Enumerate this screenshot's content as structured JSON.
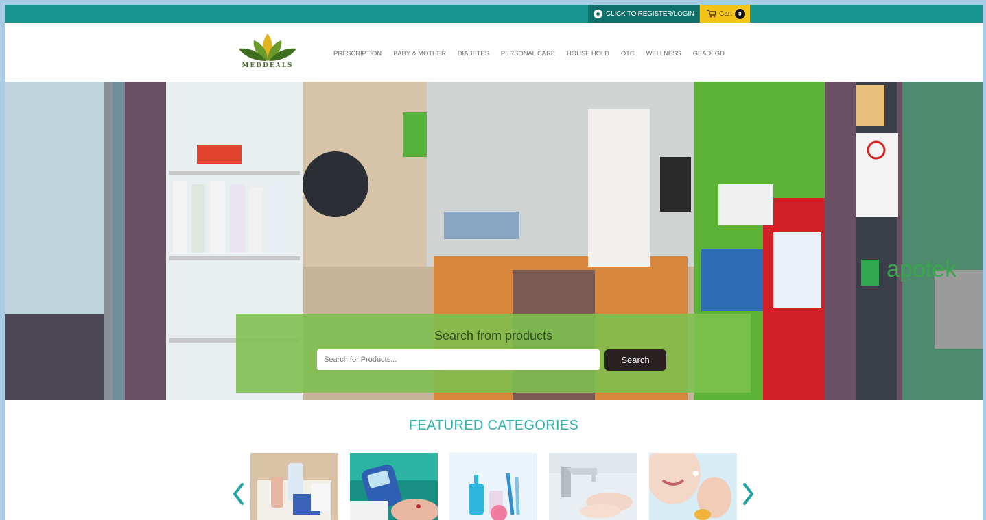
{
  "topbar": {
    "register_label": "CLICK TO REGISTER/LOGIN",
    "cart_label": "Cart",
    "cart_count": "0",
    "colors": {
      "bar": "#17958e",
      "cart": "#f3c417"
    }
  },
  "header": {
    "logo_text": "MEDDEALS",
    "nav": [
      "PRESCRIPTION",
      "BABY & MOTHER",
      "DIABETES",
      "PERSONAL CARE",
      "HOUSE HOLD",
      "OTC",
      "WELLNESS",
      "GEADFGD"
    ]
  },
  "hero": {
    "search_title": "Search from products",
    "search_placeholder": "Search for Products...",
    "search_button": "Search",
    "storefront_sign": "apotek"
  },
  "featured": {
    "title": "FEATURED CATEGORIES",
    "prev_icon": "chevron-left-icon",
    "next_icon": "chevron-right-icon",
    "accent": "#2bb3b0"
  }
}
